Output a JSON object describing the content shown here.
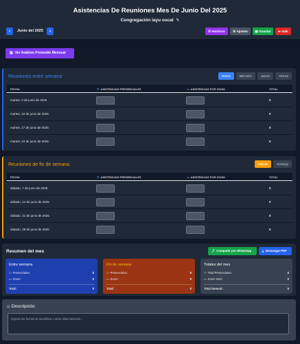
{
  "header": {
    "title": "Asistencias De Reuniones Mes De Junio Del 2025",
    "congregation": "Congregación layu oscal",
    "edit_icon": "pencil-icon",
    "prev_icon": "chevron-left-icon",
    "next_icon": "chevron-right-icon",
    "month_label": "Junio del 2025",
    "buttons": {
      "history": "Histórico",
      "settings": "Ajustes",
      "save": "Guardar",
      "exit": "Salir"
    },
    "colors": {
      "history": "#9333ea",
      "settings": "#4b5563",
      "save": "#16a34a",
      "exit": "#dc2626",
      "nav": "#2563eb"
    }
  },
  "analysis_button": "Ver Análisis Promedio Mensual",
  "week": {
    "title": "Reuniones entre semana",
    "day_tabs": [
      "Martes",
      "Miércoles",
      "Jueves",
      "Viernes"
    ],
    "active_tab": "Martes",
    "columns": {
      "date": "FECHA",
      "in_person": "ASISTENCIAS PRESENCIALES",
      "zoom": "ASISTENCIAS POR ZOOM",
      "total": "TOTAL"
    },
    "rows": [
      {
        "date": "martes, 3 de junio de 2025",
        "total": "0"
      },
      {
        "date": "martes, 10 de junio de 2025",
        "total": "0"
      },
      {
        "date": "martes, 17 de junio de 2025",
        "total": "0"
      },
      {
        "date": "martes, 24 de junio de 2025",
        "total": "0"
      }
    ]
  },
  "weekend": {
    "title": "Reuniones de fin de semana",
    "day_tabs": [
      "Sábado",
      "Domingo"
    ],
    "active_tab": "Sábado",
    "columns": {
      "date": "FECHA",
      "in_person": "ASISTENCIAS PRESENCIALES",
      "zoom": "ASISTENCIAS POR ZOOM",
      "total": "TOTAL"
    },
    "rows": [
      {
        "date": "sábado, 7 de junio de 2025",
        "total": "0"
      },
      {
        "date": "sábado, 14 de junio de 2025",
        "total": "0"
      },
      {
        "date": "sábado, 21 de junio de 2025",
        "total": "0"
      },
      {
        "date": "sábado, 28 de junio de 2025",
        "total": "0"
      }
    ]
  },
  "summary": {
    "title": "Resumen del mes",
    "share_button": "Compartir por WhatsApp",
    "pdf_button": "Descargar PDF",
    "cards": {
      "week": {
        "title": "Entre semana",
        "in_person_label": "Presenciales:",
        "in_person": "0",
        "zoom_label": "Zoom:",
        "zoom": "0",
        "total_label": "Total:",
        "total": "0",
        "color": "#1e40af"
      },
      "weekend": {
        "title": "Fin de semana",
        "in_person_label": "Presenciales:",
        "in_person": "0",
        "zoom_label": "Zoom:",
        "zoom": "0",
        "total_label": "Total:",
        "total": "0",
        "color": "#9a3412"
      },
      "totals": {
        "title": "Totales del mes",
        "in_person_label": "Total Presenciales:",
        "in_person": "0",
        "zoom_label": "Zoom total:",
        "zoom": "0",
        "total_label": "Total General:",
        "total": "0",
        "color": "#374151"
      }
    }
  },
  "description": {
    "title": "Descripción",
    "placeholder": "Ingrese las fechas de asamblea u otras observaciones..."
  }
}
